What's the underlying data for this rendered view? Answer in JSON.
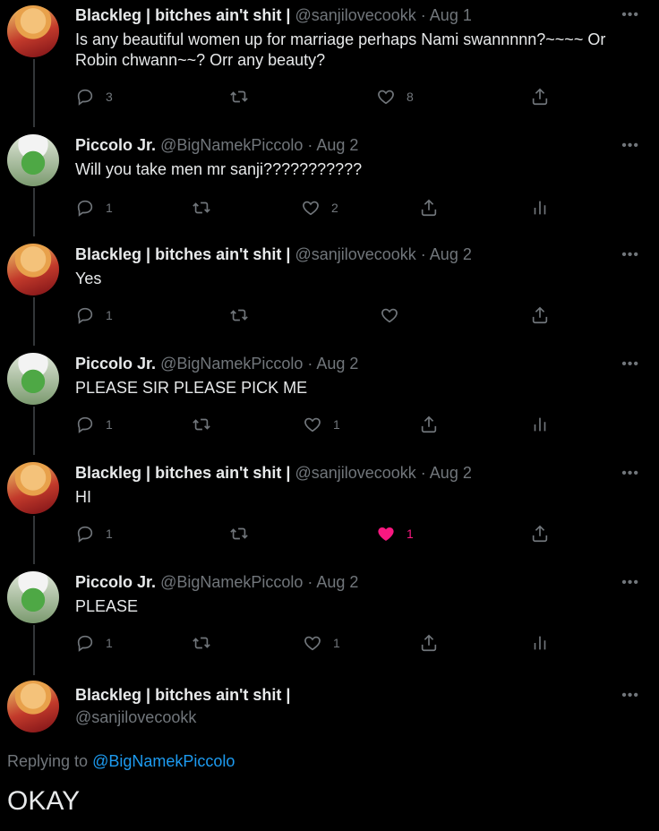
{
  "tweets": [
    {
      "name": "Blackleg | bitches ain't shit |",
      "handle": "@sanjilovecookk",
      "date": "· Aug 1",
      "text": "Is any beautiful women up for marriage perhaps Nami swannnnn?~~~~ Or Robin chwann~~? Orr any beauty?",
      "reply_count": "3",
      "retweet_count": "",
      "like_count": "8"
    },
    {
      "name": "Piccolo Jr.",
      "handle": "@BigNamekPiccolo",
      "date": "· Aug 2",
      "text": "Will you take men mr sanji???????????",
      "reply_count": "1",
      "retweet_count": "",
      "like_count": "2"
    },
    {
      "name": "Blackleg | bitches ain't shit |",
      "handle": "@sanjilovecookk",
      "date": "· Aug 2",
      "text": "Yes",
      "reply_count": "1",
      "retweet_count": "",
      "like_count": ""
    },
    {
      "name": "Piccolo Jr.",
      "handle": "@BigNamekPiccolo",
      "date": "· Aug 2",
      "text": "PLEASE SIR PLEASE PICK ME",
      "reply_count": "1",
      "retweet_count": "",
      "like_count": "1"
    },
    {
      "name": "Blackleg | bitches ain't shit |",
      "handle": "@sanjilovecookk",
      "date": "· Aug 2",
      "text": "HI",
      "reply_count": "1",
      "retweet_count": "",
      "like_count": "1"
    },
    {
      "name": "Piccolo Jr.",
      "handle": "@BigNamekPiccolo",
      "date": "· Aug 2",
      "text": "PLEASE",
      "reply_count": "1",
      "retweet_count": "",
      "like_count": "1"
    }
  ],
  "main_tweet": {
    "name": "Blackleg | bitches ain't shit |",
    "handle": "@sanjilovecookk",
    "replying_prefix": "Replying to",
    "replying_to": "@BigNamekPiccolo",
    "text": "OKAY"
  },
  "colors": {
    "background": "#000000",
    "muted": "#71767b",
    "link": "#1d9bf0",
    "like_active": "#f91880"
  },
  "icons": [
    "reply-icon",
    "retweet-icon",
    "like-icon",
    "share-icon",
    "analytics-icon",
    "more-icon"
  ]
}
